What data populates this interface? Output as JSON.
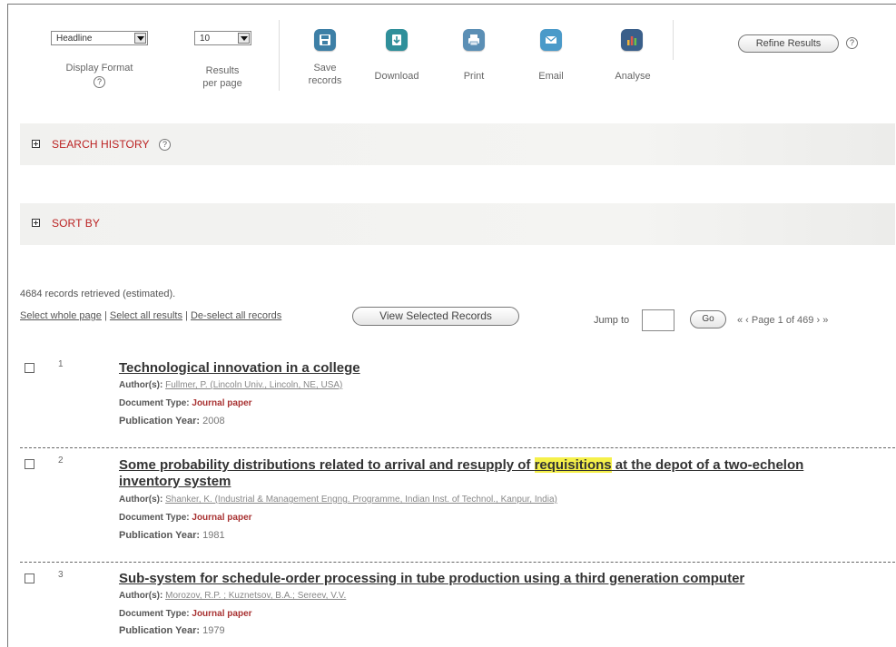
{
  "toolbar": {
    "display_format": {
      "value": "Headline",
      "label": "Display Format"
    },
    "results_per_page": {
      "value": "10",
      "label_line1": "Results",
      "label_line2": "per page"
    },
    "save": {
      "line1": "Save",
      "line2": "records",
      "icon": "save-icon"
    },
    "download": {
      "label": "Download",
      "icon": "download-icon"
    },
    "print": {
      "label": "Print",
      "icon": "print-icon"
    },
    "email": {
      "label": "Email",
      "icon": "email-icon"
    },
    "analyse": {
      "label": "Analyse",
      "icon": "analyse-icon"
    },
    "refine_results": "Refine Results",
    "help": "?"
  },
  "sections": {
    "search_history": "SEARCH HISTORY",
    "sort_by": "SORT BY"
  },
  "results_info": {
    "count_text": "4684 records retrieved (estimated).",
    "select_whole_page": "Select whole page",
    "select_all_results": "Select all results",
    "deselect_all": "De-select all records",
    "view_selected": "View Selected Records",
    "separator": "|",
    "jump_to_label": "Jump to",
    "jump_to_value": "",
    "go_button": "Go",
    "first_prev": "« ‹",
    "page_text": "Page 1 of 469",
    "next_last": "› »"
  },
  "records": [
    {
      "number": "1",
      "title": "Technological innovation in a college",
      "authors_label": "Author(s):",
      "authors": "Fullmer, P. (Lincoln Univ., Lincoln, NE, USA)",
      "doctype_label": "Document Type:",
      "doctype": "Journal paper",
      "year_label": "Publication Year:",
      "year": "2008"
    },
    {
      "number": "2",
      "title_before": "Some probability distributions related to arrival and resupply of ",
      "title_highlight": "requisitions",
      "title_after_line1": " at the depot of a two-echelon",
      "title_line2": "inventory system",
      "authors_label": "Author(s):",
      "authors": "Shanker, K. (Industrial & Management Engng. Programme, Indian Inst. of Technol., Kanpur, India)",
      "doctype_label": "Document Type:",
      "doctype": "Journal paper",
      "year_label": "Publication Year:",
      "year": "1981"
    },
    {
      "number": "3",
      "title": "Sub-system for schedule-order processing in tube production using a third generation computer",
      "authors_label": "Author(s):",
      "authors": "Morozov, R.P. ; Kuznetsov, B.A.; Sereev, V.V.",
      "doctype_label": "Document Type:",
      "doctype": "Journal paper",
      "year_label": "Publication Year:",
      "year": "1979"
    }
  ],
  "colors": {
    "section_title": "#b22222",
    "doctype": "#a83232",
    "highlight": "#f5f04a",
    "save_icon": "#3d7fa6",
    "download_icon": "#2f8f9a",
    "print_icon": "#5b8fb5",
    "email_icon": "#4a9ac9",
    "analyse_icon": "#3a5f8a"
  }
}
